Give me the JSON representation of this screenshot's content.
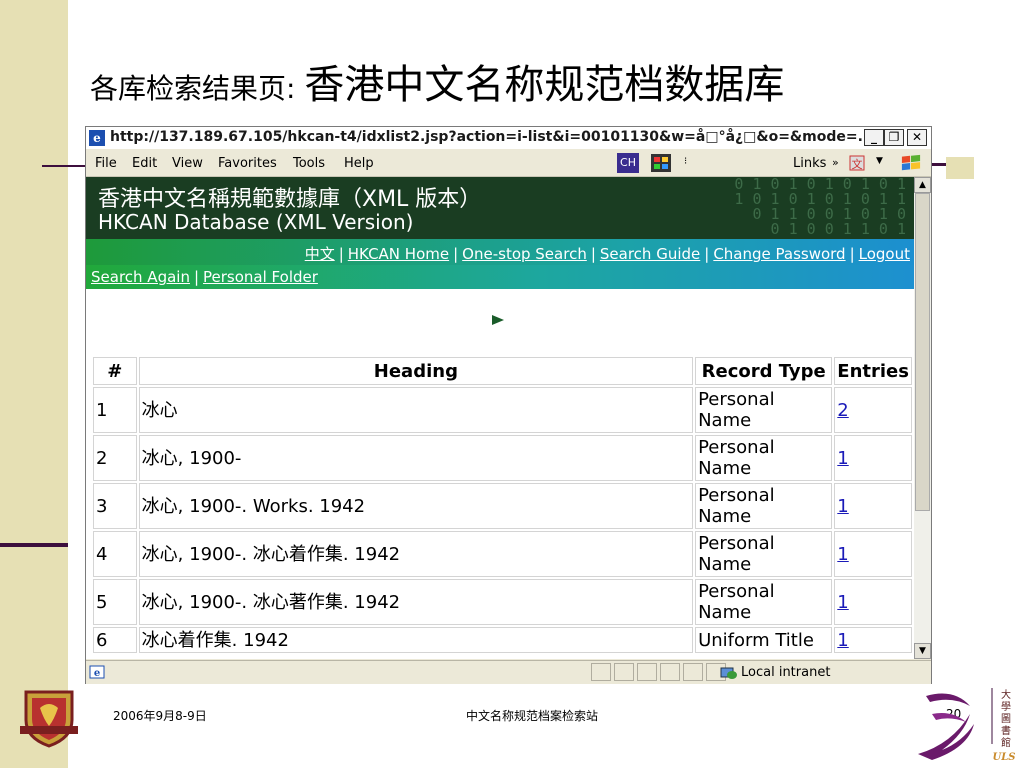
{
  "slide": {
    "title_prefix": "各库检索结果页: ",
    "title_main": "香港中文名称规范档数据库",
    "footer_date": "2006年9月8-9日",
    "footer_center": "中文名称规范档案检索站",
    "page_number": "20",
    "library_text": "大學圖書館",
    "library_abbr": "ULS"
  },
  "browser": {
    "title_url": "http://137.189.67.105/hkcan-t4/idxlist2.jsp?action=i-list&i=00101130&w=å□°å¿□&o=&mode=...",
    "menu": [
      "File",
      "Edit",
      "View",
      "Favorites",
      "Tools",
      "Help"
    ],
    "lang_button": "CH",
    "links_label": "Links",
    "status_zone": "Local intranet"
  },
  "page": {
    "banner_cn": "香港中文名稱規範數據庫（XML 版本）",
    "banner_en": "HKCAN Database (XML Version)",
    "nav_links": [
      "中文",
      "HKCAN Home",
      "One-stop Search",
      "Search Guide",
      "Change Password",
      "Logout"
    ],
    "sub_links": [
      "Search Again",
      "Personal Folder"
    ],
    "table": {
      "headers": [
        "#",
        "Heading",
        "Record Type",
        "Entries"
      ],
      "rows": [
        {
          "num": "1",
          "heading": "冰心",
          "type": "Personal Name",
          "entries": "2"
        },
        {
          "num": "2",
          "heading": "冰心, 1900-",
          "type": "Personal Name",
          "entries": "1"
        },
        {
          "num": "3",
          "heading": "冰心, 1900-. Works. 1942",
          "type": "Personal Name",
          "entries": "1"
        },
        {
          "num": "4",
          "heading": "冰心, 1900-. 冰心着作集. 1942",
          "type": "Personal Name",
          "entries": "1"
        },
        {
          "num": "5",
          "heading": "冰心, 1900-. 冰心著作集. 1942",
          "type": "Personal Name",
          "entries": "1"
        },
        {
          "num": "6",
          "heading": "冰心着作集. 1942",
          "type": "Uniform Title",
          "entries": "1"
        }
      ]
    }
  },
  "colors": {
    "band": "#e6e0b4",
    "rule": "#3d0f3d",
    "banner": "#1a3d22",
    "link": "#1a1ab8"
  }
}
